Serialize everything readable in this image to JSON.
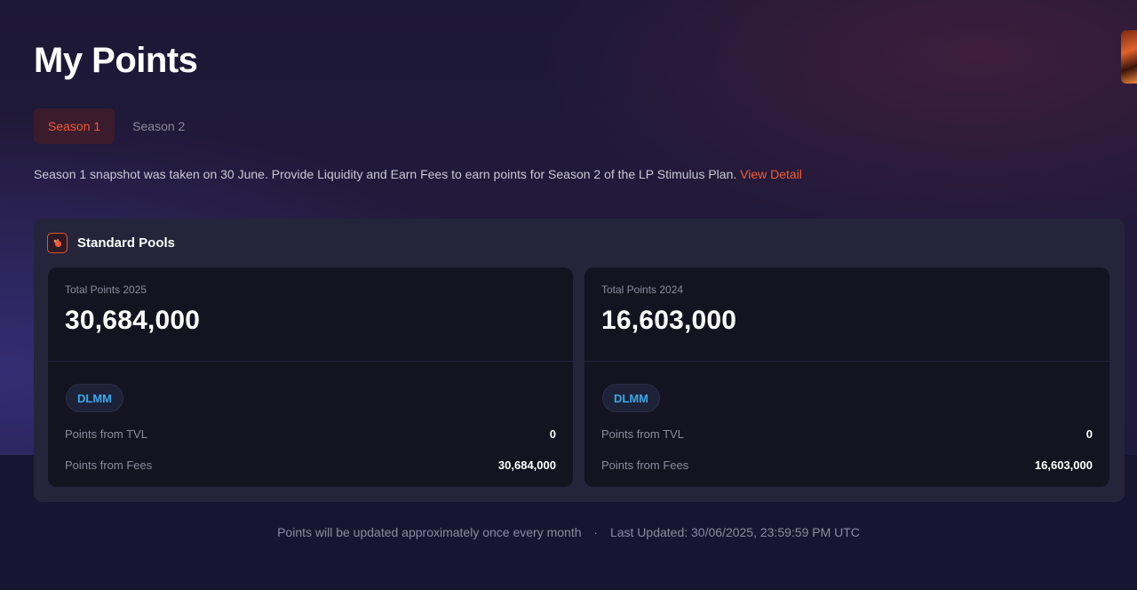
{
  "page": {
    "title": "My Points"
  },
  "tabs": [
    {
      "label": "Season 1",
      "active": true
    },
    {
      "label": "Season 2",
      "active": false
    }
  ],
  "notice": {
    "text": "Season 1 snapshot was taken on 30 June. Provide Liquidity and Earn Fees to earn points for Season 2 of the LP Stimulus Plan.",
    "link": "View Detail"
  },
  "pools": {
    "title": "Standard Pools",
    "icon": "flame-icon",
    "cards": [
      {
        "label": "Total Points 2025",
        "value": "30,684,000",
        "badge": "DLMM",
        "rows": [
          {
            "label": "Points from TVL",
            "value": "0"
          },
          {
            "label": "Points from Fees",
            "value": "30,684,000"
          }
        ]
      },
      {
        "label": "Total Points 2024",
        "value": "16,603,000",
        "badge": "DLMM",
        "rows": [
          {
            "label": "Points from TVL",
            "value": "0"
          },
          {
            "label": "Points from Fees",
            "value": "16,603,000"
          }
        ]
      }
    ]
  },
  "footer": {
    "note": "Points will be updated approximately once every month",
    "separator": "·",
    "updated": "Last Updated: 30/06/2025, 23:59:59 PM UTC"
  },
  "colors": {
    "accent": "#f25c34",
    "badge_text": "#3aa8e8",
    "card_bg": "#141320",
    "panel_bg": "#25243a"
  }
}
